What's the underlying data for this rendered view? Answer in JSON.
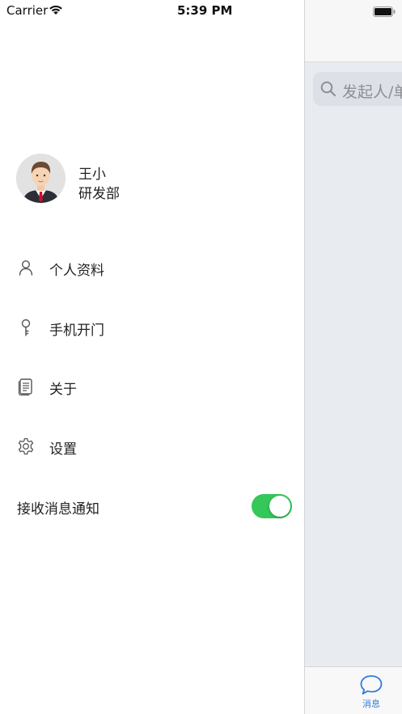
{
  "status_bar": {
    "carrier": "Carrier",
    "time": "5:39 PM"
  },
  "user": {
    "name": "王小",
    "department": "研发部"
  },
  "menu": [
    {
      "label": "个人资料",
      "icon": "person-icon"
    },
    {
      "label": "手机开门",
      "icon": "key-icon"
    },
    {
      "label": "关于",
      "icon": "document-icon"
    },
    {
      "label": "设置",
      "icon": "gear-icon"
    }
  ],
  "notification": {
    "label": "接收消息通知",
    "enabled": true
  },
  "main_screen": {
    "search_placeholder": "发起人/单",
    "tab_messages_label": "消息"
  },
  "colors": {
    "toggle_on": "#34c759",
    "tab_active": "#2f7bd8",
    "main_background": "#e8ebf0"
  }
}
